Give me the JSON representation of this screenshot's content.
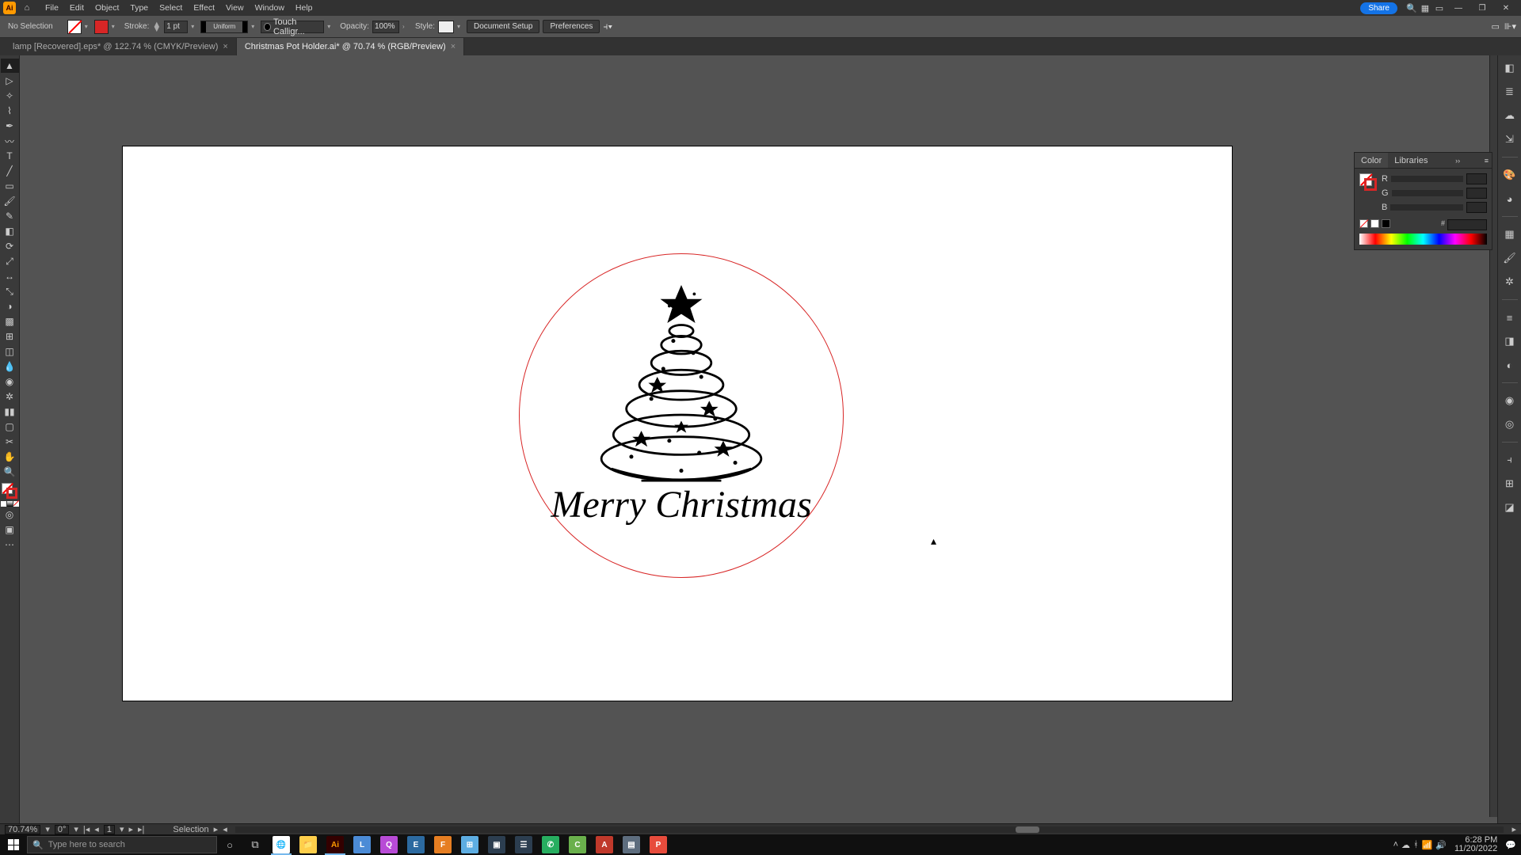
{
  "menubar": {
    "items": [
      "File",
      "Edit",
      "Object",
      "Type",
      "Select",
      "Effect",
      "View",
      "Window",
      "Help"
    ],
    "share": "Share"
  },
  "controlbar": {
    "selection_label": "No Selection",
    "stroke_label": "Stroke:",
    "stroke_weight": "1 pt",
    "profile": "Uniform",
    "brush": "Touch Calligr...",
    "opacity_label": "Opacity:",
    "opacity_value": "100%",
    "style_label": "Style:",
    "doc_setup": "Document Setup",
    "preferences": "Preferences"
  },
  "tabs": [
    {
      "label": "lamp [Recovered].eps* @ 122.74 % (CMYK/Preview)",
      "active": false
    },
    {
      "label": "Christmas Pot Holder.ai* @ 70.74 % (RGB/Preview)",
      "active": true
    }
  ],
  "artwork": {
    "text": "Merry Christmas",
    "circle_stroke": "#d82626"
  },
  "color_panel": {
    "tab_color": "Color",
    "tab_libraries": "Libraries",
    "channels": [
      "R",
      "G",
      "B"
    ],
    "hex_label": "#"
  },
  "statusbar": {
    "zoom": "70.74%",
    "rotation": "0°",
    "artboard_nav": "1",
    "tool": "Selection"
  },
  "taskbar": {
    "search_placeholder": "Type here to search",
    "time": "6:28 PM",
    "date": "11/20/2022"
  }
}
